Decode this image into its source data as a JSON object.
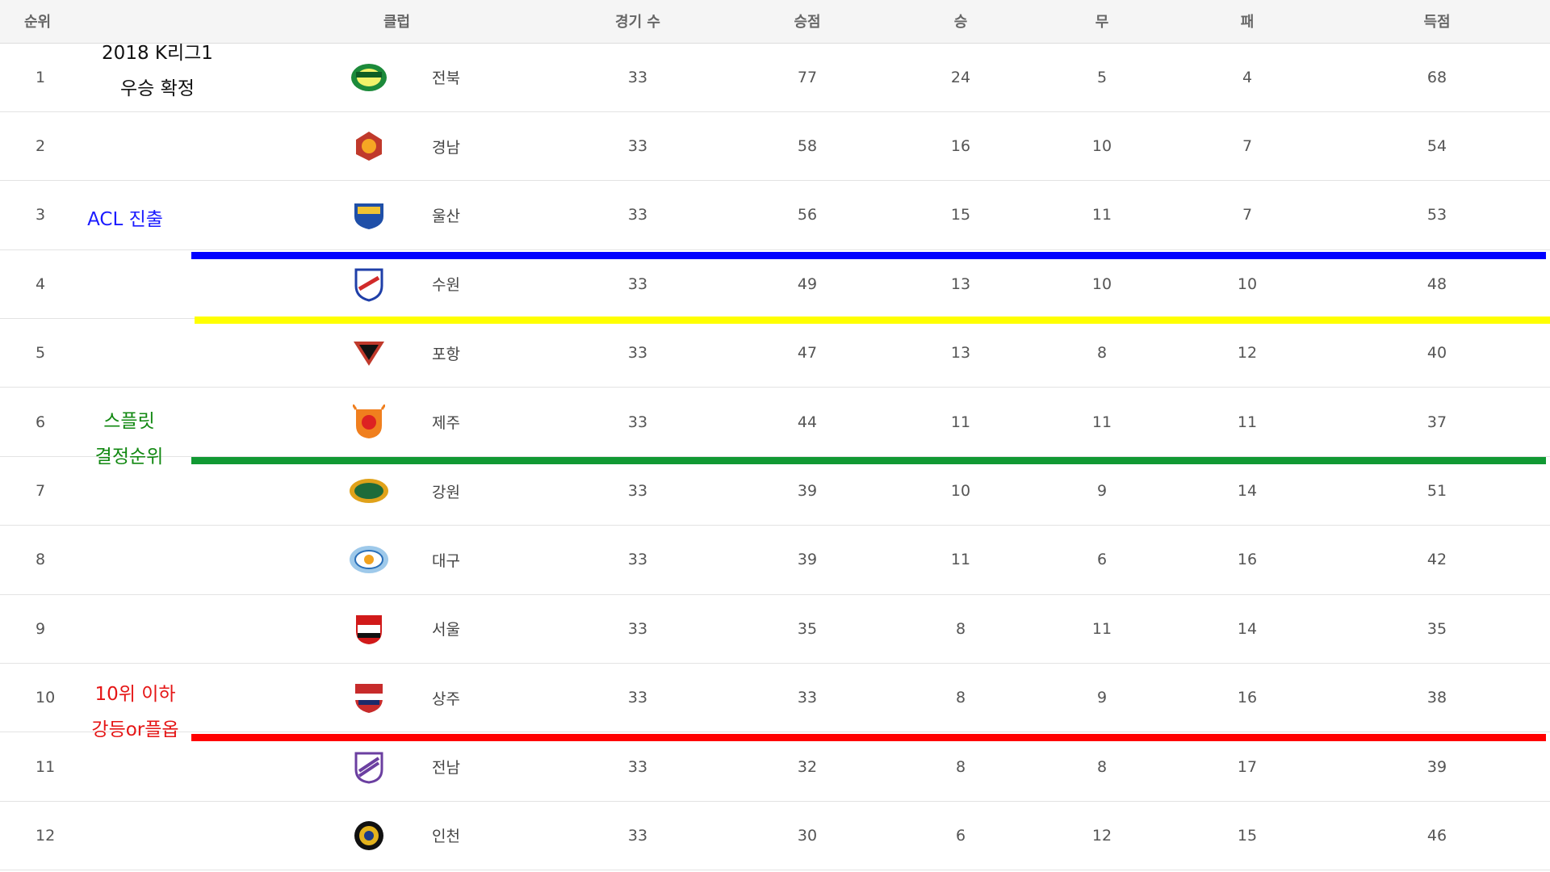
{
  "headers": {
    "rank": "순위",
    "club": "클럽",
    "games": "경기 수",
    "points": "승점",
    "wins": "승",
    "draws": "무",
    "losses": "패",
    "goals": "득점"
  },
  "rows": [
    {
      "rank": "1",
      "club": "전북",
      "games": "33",
      "points": "77",
      "wins": "24",
      "draws": "5",
      "losses": "4",
      "goals": "68"
    },
    {
      "rank": "2",
      "club": "경남",
      "games": "33",
      "points": "58",
      "wins": "16",
      "draws": "10",
      "losses": "7",
      "goals": "54"
    },
    {
      "rank": "3",
      "club": "울산",
      "games": "33",
      "points": "56",
      "wins": "15",
      "draws": "11",
      "losses": "7",
      "goals": "53"
    },
    {
      "rank": "4",
      "club": "수원",
      "games": "33",
      "points": "49",
      "wins": "13",
      "draws": "10",
      "losses": "10",
      "goals": "48"
    },
    {
      "rank": "5",
      "club": "포항",
      "games": "33",
      "points": "47",
      "wins": "13",
      "draws": "8",
      "losses": "12",
      "goals": "40"
    },
    {
      "rank": "6",
      "club": "제주",
      "games": "33",
      "points": "44",
      "wins": "11",
      "draws": "11",
      "losses": "11",
      "goals": "37"
    },
    {
      "rank": "7",
      "club": "강원",
      "games": "33",
      "points": "39",
      "wins": "10",
      "draws": "9",
      "losses": "14",
      "goals": "51"
    },
    {
      "rank": "8",
      "club": "대구",
      "games": "33",
      "points": "39",
      "wins": "11",
      "draws": "6",
      "losses": "16",
      "goals": "42"
    },
    {
      "rank": "9",
      "club": "서울",
      "games": "33",
      "points": "35",
      "wins": "8",
      "draws": "11",
      "losses": "14",
      "goals": "35"
    },
    {
      "rank": "10",
      "club": "상주",
      "games": "33",
      "points": "33",
      "wins": "8",
      "draws": "9",
      "losses": "16",
      "goals": "38"
    },
    {
      "rank": "11",
      "club": "전남",
      "games": "33",
      "points": "32",
      "wins": "8",
      "draws": "8",
      "losses": "17",
      "goals": "39"
    },
    {
      "rank": "12",
      "club": "인천",
      "games": "33",
      "points": "30",
      "wins": "6",
      "draws": "12",
      "losses": "15",
      "goals": "46"
    }
  ],
  "annotations": {
    "champion_line1": "2018 K리그1",
    "champion_line2": "우승 확정",
    "acl": "ACL 진출",
    "split_line1": "스플릿",
    "split_line2": "결정순위",
    "relegation_line1": "10위 이하",
    "relegation_line2": "강등or플옵"
  },
  "colors": {
    "acl_line": "#0000ff",
    "fourth_line": "#ffff00",
    "split_line": "#119933",
    "relegation_line": "#ff0000"
  }
}
